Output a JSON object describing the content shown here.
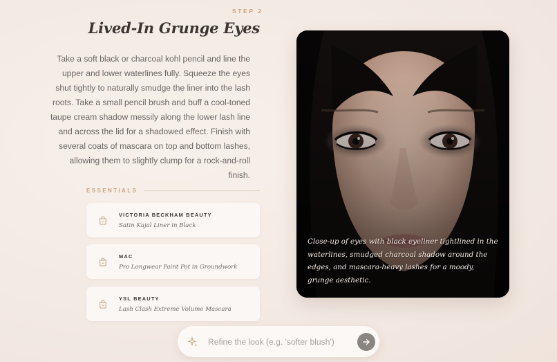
{
  "step": {
    "label": "STEP 2"
  },
  "look": {
    "title": "Lived-In Grunge Eyes",
    "description": "Take a soft black or charcoal kohl pencil and line the upper and lower waterlines fully. Squeeze the eyes shut tightly to naturally smudge the liner into the lash roots. Take a small pencil brush and buff a cool-toned taupe cream shadow messily along the lower lash line and across the lid for a shadowed effect. Finish with several coats of mascara on top and bottom lashes, allowing them to slightly clump for a rock-and-roll finish."
  },
  "essentials": {
    "label": "ESSENTIALS",
    "products": [
      {
        "brand": "VICTORIA BECKHAM BEAUTY",
        "name": "Satin Kajal Liner in Black",
        "icon": "shopping-bag-icon"
      },
      {
        "brand": "MAC",
        "name": "Pro Longwear Paint Pot in Groundwork",
        "icon": "shopping-bag-icon"
      },
      {
        "brand": "YSL BEAUTY",
        "name": "Lash Clash Extreme Volume Mascara",
        "icon": "shopping-bag-icon"
      }
    ]
  },
  "photo": {
    "caption": "Close-up of eyes with black eyeliner tightlined in the waterlines, smudged charcoal shadow around the edges, and mascara-heavy lashes for a moody, grunge aesthetic."
  },
  "refine": {
    "placeholder": "Refine the look (e.g. 'softer blush')",
    "value": "",
    "icon": "sparkle-icon",
    "submit_icon": "arrow-right-icon"
  },
  "colors": {
    "accent": "#c9a27e",
    "background": "#f3e9e3",
    "title": "#3c3633",
    "submit_button": "#8a8580"
  }
}
